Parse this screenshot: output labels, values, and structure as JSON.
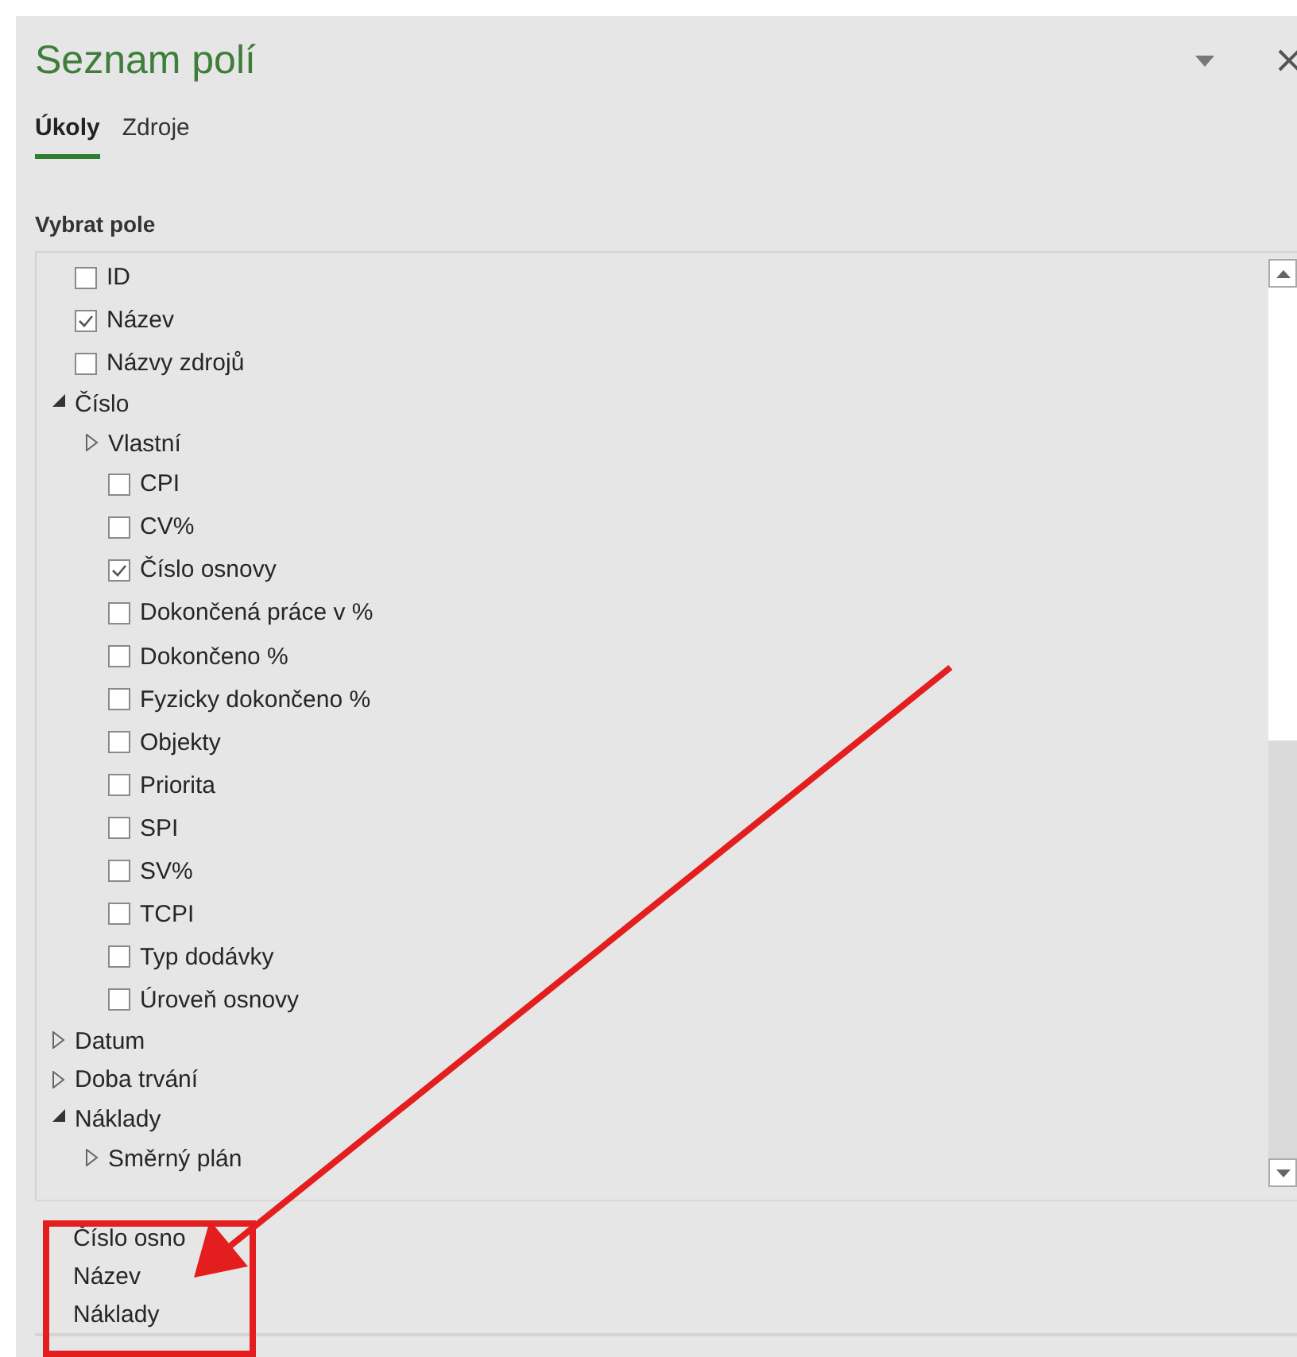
{
  "pane": {
    "title": "Seznam polí"
  },
  "tabs": [
    {
      "label": "Úkoly",
      "selected": true
    },
    {
      "label": "Zdroje",
      "selected": false
    }
  ],
  "section_label": "Vybrat pole",
  "fields": [
    {
      "kind": "checkbox",
      "label": "ID",
      "checked": false
    },
    {
      "kind": "checkbox",
      "label": "Název",
      "checked": true
    },
    {
      "kind": "checkbox",
      "label": "Názvy zdrojů",
      "checked": false
    },
    {
      "kind": "group",
      "label": "Číslo",
      "expanded": true,
      "children": [
        {
          "kind": "group",
          "label": "Vlastní",
          "expanded": false
        },
        {
          "kind": "checkbox",
          "label": "CPI",
          "checked": false
        },
        {
          "kind": "checkbox",
          "label": "CV%",
          "checked": false
        },
        {
          "kind": "checkbox",
          "label": "Číslo osnovy",
          "checked": true
        },
        {
          "kind": "checkbox",
          "label": "Dokončená práce v %",
          "checked": false
        },
        {
          "kind": "checkbox",
          "label": "Dokončeno %",
          "checked": false
        },
        {
          "kind": "checkbox",
          "label": "Fyzicky dokončeno %",
          "checked": false
        },
        {
          "kind": "checkbox",
          "label": "Objekty",
          "checked": false
        },
        {
          "kind": "checkbox",
          "label": "Priorita",
          "checked": false
        },
        {
          "kind": "checkbox",
          "label": "SPI",
          "checked": false
        },
        {
          "kind": "checkbox",
          "label": "SV%",
          "checked": false
        },
        {
          "kind": "checkbox",
          "label": "TCPI",
          "checked": false
        },
        {
          "kind": "checkbox",
          "label": "Typ dodávky",
          "checked": false
        },
        {
          "kind": "checkbox",
          "label": "Úroveň osnovy",
          "checked": false
        }
      ]
    },
    {
      "kind": "group",
      "label": "Datum",
      "expanded": false
    },
    {
      "kind": "group",
      "label": "Doba trvání",
      "expanded": false
    },
    {
      "kind": "group",
      "label": "Náklady",
      "expanded": true,
      "children": [
        {
          "kind": "group",
          "label": "Směrný plán",
          "expanded": false
        }
      ]
    }
  ],
  "selected_fields": [
    "Číslo osno",
    "Název",
    "Náklady"
  ]
}
